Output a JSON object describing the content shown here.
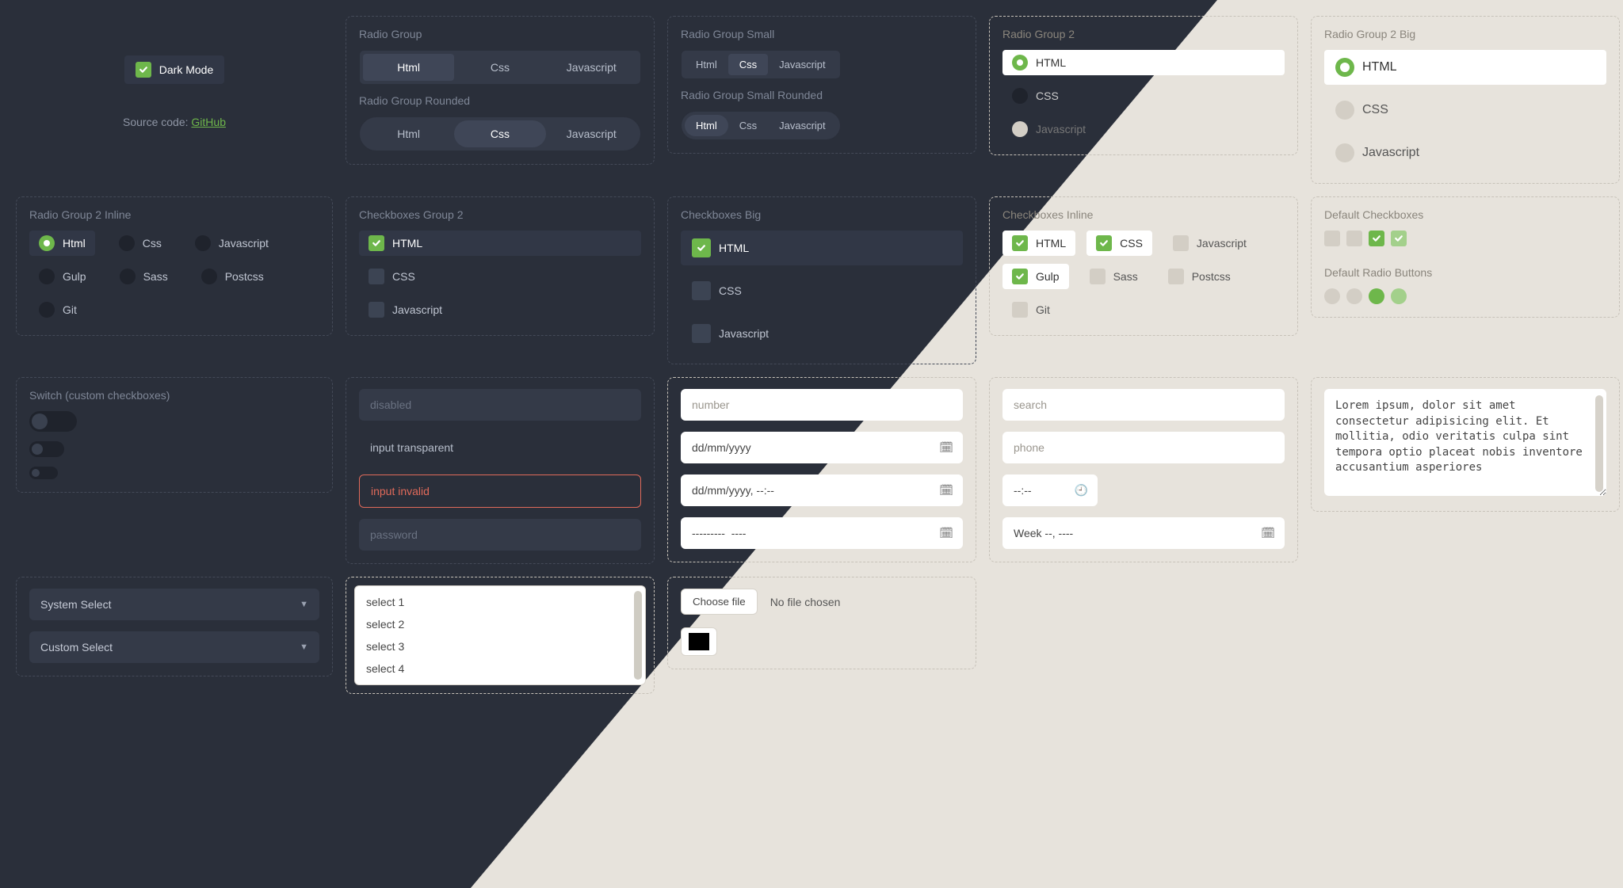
{
  "darkMode": {
    "label": "Dark Mode"
  },
  "sourceCode": {
    "prefix": "Source code: ",
    "linkText": "GitHub"
  },
  "radioGroup": {
    "title": "Radio Group",
    "items": [
      "Html",
      "Css",
      "Javascript"
    ],
    "active": 0
  },
  "radioGroupRounded": {
    "title": "Radio Group Rounded",
    "items": [
      "Html",
      "Css",
      "Javascript"
    ],
    "active": 1
  },
  "radioGroupSmall": {
    "title": "Radio Group Small",
    "items": [
      "Html",
      "Css",
      "Javascript"
    ],
    "active": 1
  },
  "radioGroupSmallRounded": {
    "title": "Radio Group Small Rounded",
    "items": [
      "Html",
      "Css",
      "Javascript"
    ],
    "active": 0
  },
  "radioGroup2": {
    "title": "Radio Group 2",
    "items": [
      "HTML",
      "CSS",
      "Javascript"
    ],
    "active": 0
  },
  "radioGroup2Big": {
    "title": "Radio Group 2 Big",
    "items": [
      "HTML",
      "CSS",
      "Javascript"
    ],
    "active": 0
  },
  "radioGroup2Inline": {
    "title": "Radio Group 2 Inline",
    "items": [
      "Html",
      "Css",
      "Javascript",
      "Gulp",
      "Sass",
      "Postcss",
      "Git"
    ],
    "active": 0
  },
  "checkboxes2": {
    "title": "Checkboxes Group 2",
    "items": [
      {
        "label": "HTML",
        "on": true
      },
      {
        "label": "CSS",
        "on": false
      },
      {
        "label": "Javascript",
        "on": false
      }
    ]
  },
  "checkboxesBig": {
    "title": "Checkboxes Big",
    "items": [
      {
        "label": "HTML",
        "on": true
      },
      {
        "label": "CSS",
        "on": false
      },
      {
        "label": "Javascript",
        "on": false
      }
    ]
  },
  "checkboxesInline": {
    "title": "Checkboxes Inline",
    "items": [
      {
        "label": "HTML",
        "on": true
      },
      {
        "label": "CSS",
        "on": true
      },
      {
        "label": "Javascript",
        "on": false
      },
      {
        "label": "Gulp",
        "on": true
      },
      {
        "label": "Sass",
        "on": false
      },
      {
        "label": "Postcss",
        "on": false
      },
      {
        "label": "Git",
        "on": false
      }
    ]
  },
  "defaultCheckboxes": {
    "title": "Default Checkboxes"
  },
  "defaultRadios": {
    "title": "Default Radio Buttons"
  },
  "switches": {
    "title": "Switch (custom checkboxes)"
  },
  "inputs": {
    "disabled": "disabled",
    "transparent": "input transparent",
    "invalid": "input invalid",
    "password": "password",
    "number": "number",
    "date": "dd/mm/yyyy",
    "datetime": "dd/mm/yyyy, --:--",
    "month": "---------  ----",
    "search": "search",
    "phone": "phone",
    "time": "--:--",
    "week": "Week --, ----"
  },
  "selects": {
    "system": "System Select",
    "custom": "Custom Select",
    "list": [
      "select 1",
      "select 2",
      "select 3",
      "select 4"
    ]
  },
  "file": {
    "button": "Choose file",
    "status": "No file chosen"
  },
  "textarea": "Lorem ipsum, dolor sit amet consectetur adipisicing elit. Et mollitia, odio veritatis culpa sint tempora optio placeat nobis inventore accusantium asperiores"
}
